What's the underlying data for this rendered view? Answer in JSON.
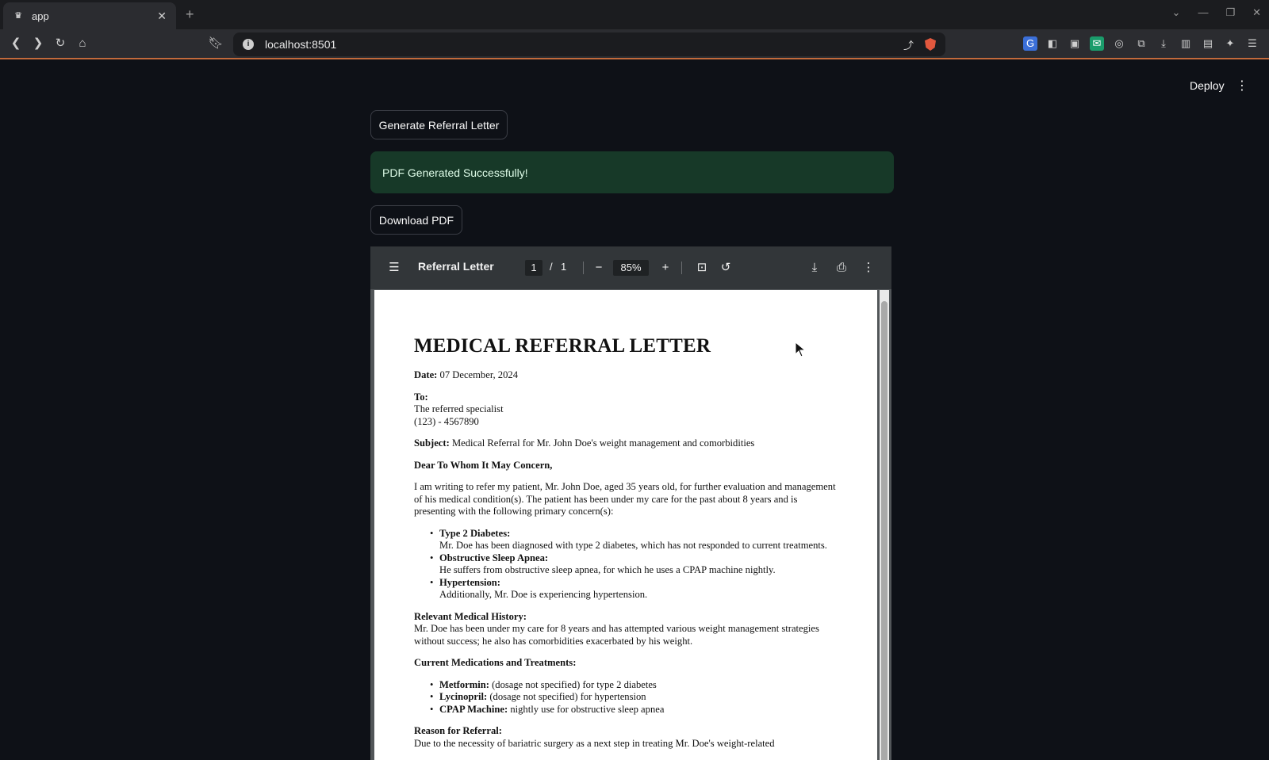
{
  "browser": {
    "tab_title": "app",
    "url": "localhost:8501"
  },
  "app": {
    "deploy_label": "Deploy",
    "generate_button": "Generate Referral Letter",
    "success_message": "PDF Generated Successfully!",
    "download_button": "Download PDF"
  },
  "pdf_viewer": {
    "title": "Referral Letter",
    "current_page": "1",
    "page_separator": "/",
    "total_pages": "1",
    "zoom": "85%"
  },
  "letter": {
    "heading": "MEDICAL REFERRAL LETTER",
    "date_label": "Date:",
    "date_value": "07 December, 2024",
    "to_label": "To:",
    "to_line1": "The referred specialist",
    "to_line2": "(123) - 4567890",
    "subject_label": "Subject:",
    "subject_value": "Medical Referral for Mr. John Doe's weight management and comorbidities",
    "salutation": "Dear To Whom It May Concern,",
    "intro": "I am writing to refer my patient, Mr. John Doe, aged 35 years old, for further evaluation and management of his medical condition(s). The patient has been under my care for the past about 8 years and is presenting with the following primary concern(s):",
    "concerns": [
      {
        "title": "Type 2 Diabetes:",
        "text": "Mr. Doe has been diagnosed with type 2 diabetes, which has not responded to current treatments."
      },
      {
        "title": "Obstructive Sleep Apnea:",
        "text": "He suffers from obstructive sleep apnea, for which he uses a CPAP machine nightly."
      },
      {
        "title": "Hypertension:",
        "text": "Additionally, Mr. Doe is experiencing hypertension."
      }
    ],
    "history_label": "Relevant Medical History:",
    "history_text": "Mr. Doe has been under my care for 8 years and has attempted various weight management strategies without success; he also has comorbidities exacerbated by his weight.",
    "meds_label": "Current Medications and Treatments:",
    "meds": [
      {
        "name": "Metformin:",
        "detail": "(dosage not specified) for type 2 diabetes"
      },
      {
        "name": "Lycinopril:",
        "detail": "(dosage not specified) for hypertension"
      },
      {
        "name": "CPAP Machine:",
        "detail": "nightly use for obstructive sleep apnea"
      }
    ],
    "reason_label": "Reason for Referral:",
    "reason_text": "Due to the necessity of bariatric surgery as a next step in treating Mr. Doe's weight-related"
  }
}
